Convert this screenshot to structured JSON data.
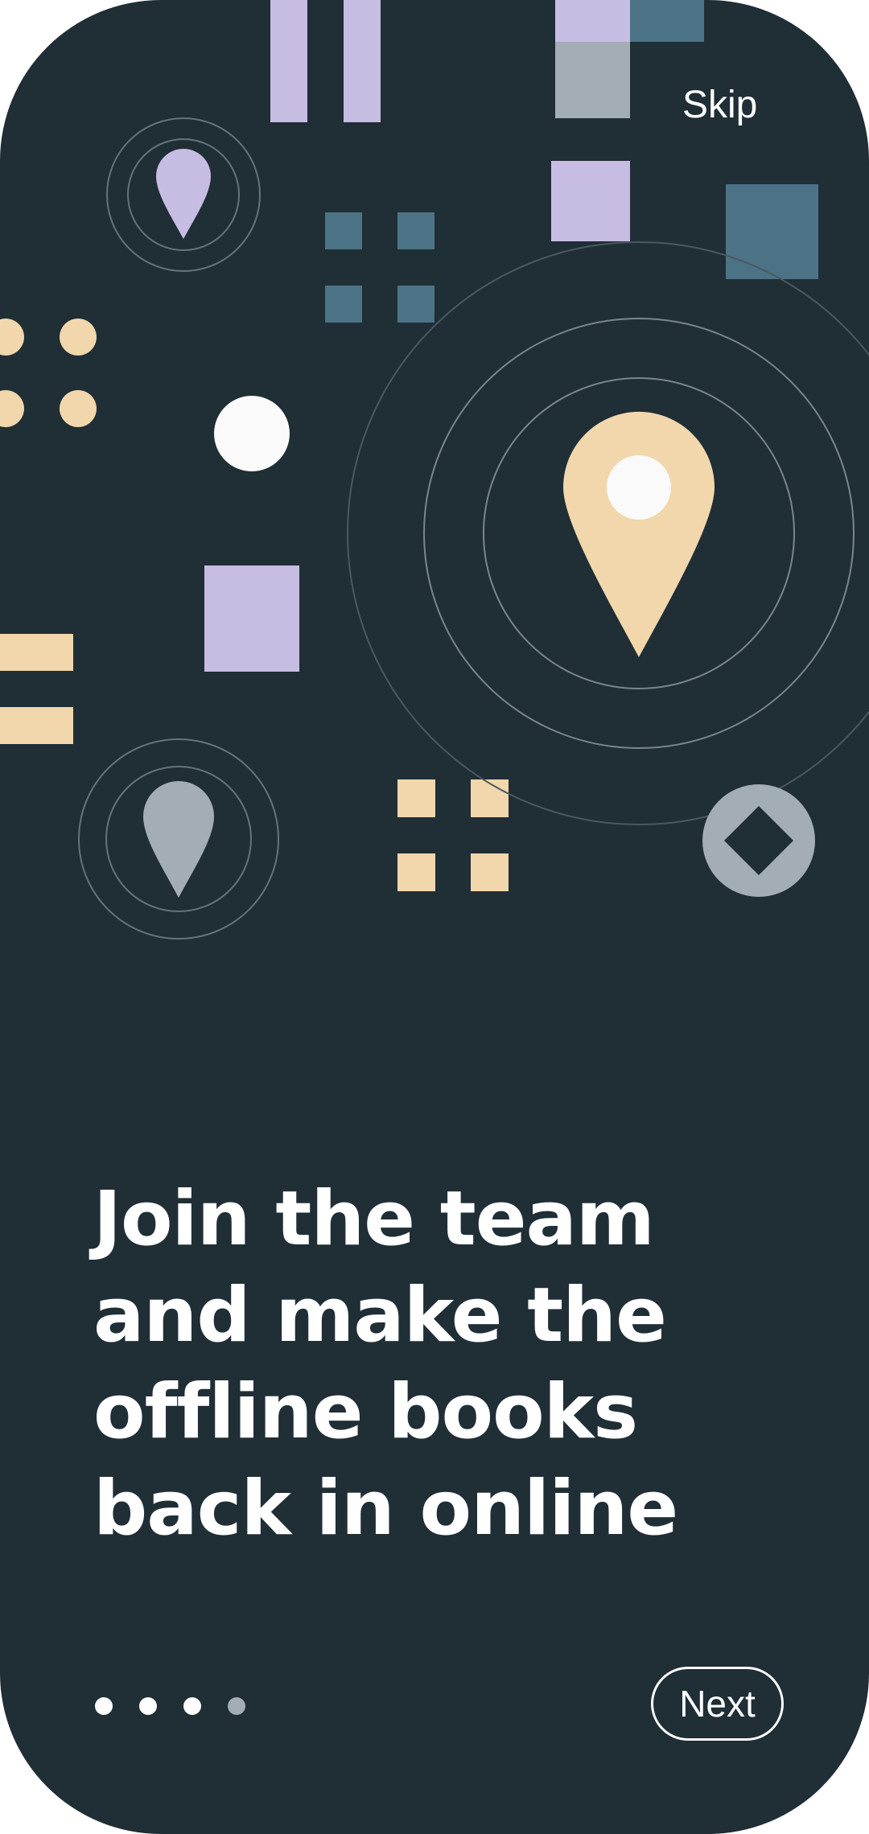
{
  "onboarding": {
    "skip_label": "Skip",
    "headline_lines": [
      "Join the team",
      "and make the",
      "offline books",
      "back in online"
    ],
    "page_indicator": {
      "total": 4,
      "active_dots": 3
    },
    "next_label": "Next"
  },
  "colors": {
    "background": "#202e36",
    "lavender": "#c7bde3",
    "peach": "#f1d7ab",
    "teal": "#4c7385",
    "grey": "#a3adb5",
    "white": "#fafafa"
  },
  "icons": [
    "map-pin-icon",
    "diamond-icon"
  ]
}
